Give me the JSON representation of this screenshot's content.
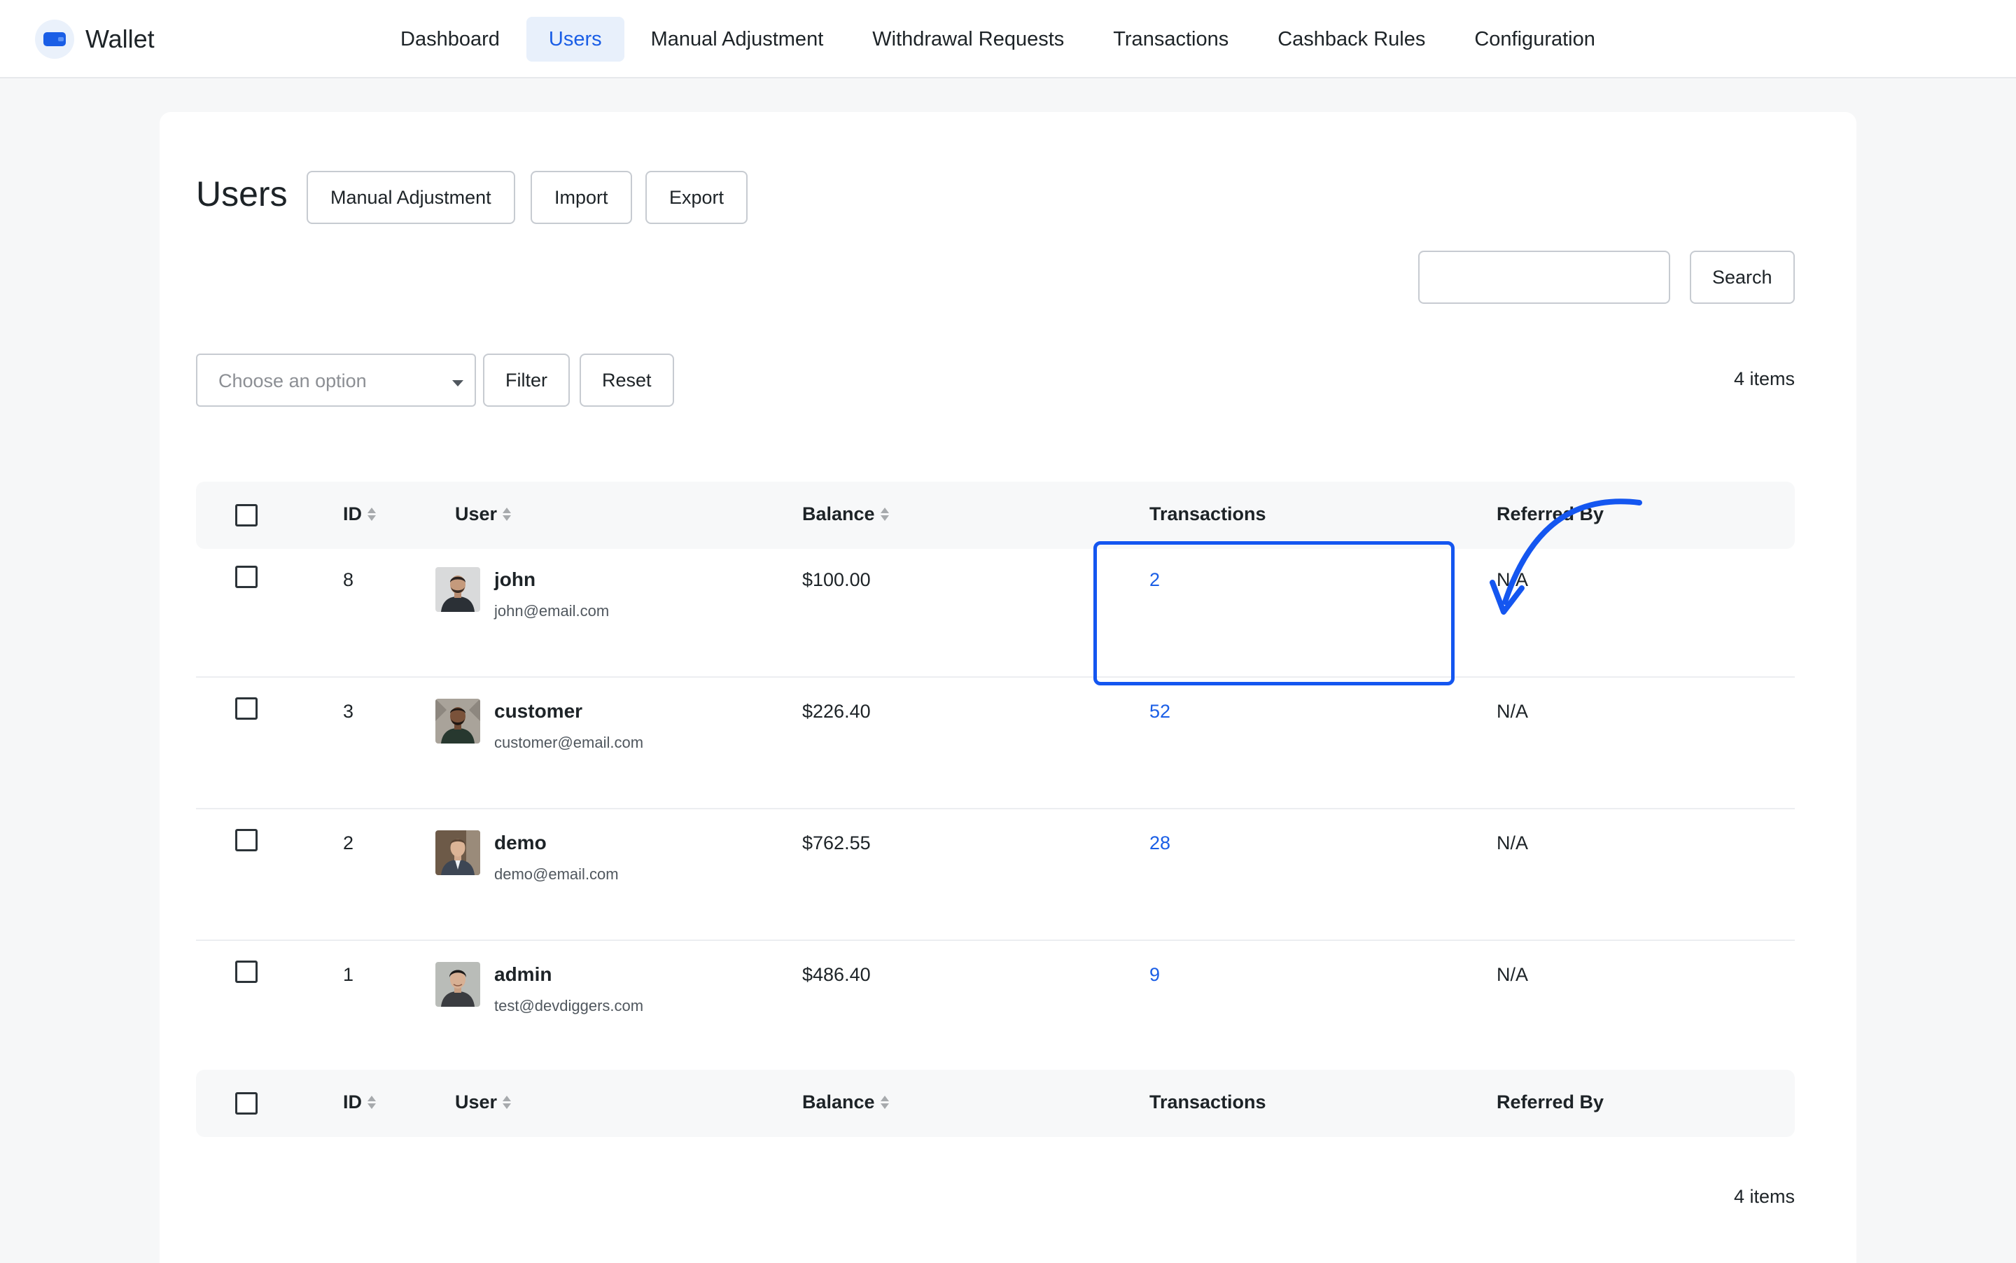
{
  "brand": {
    "name": "Wallet"
  },
  "nav": {
    "items": [
      {
        "label": "Dashboard"
      },
      {
        "label": "Users"
      },
      {
        "label": "Manual Adjustment"
      },
      {
        "label": "Withdrawal Requests"
      },
      {
        "label": "Transactions"
      },
      {
        "label": "Cashback Rules"
      },
      {
        "label": "Configuration"
      }
    ],
    "active": "Users"
  },
  "page": {
    "title": "Users",
    "actions": {
      "manual_adjustment": "Manual Adjustment",
      "import": "Import",
      "export": "Export"
    }
  },
  "search": {
    "value": "",
    "button": "Search"
  },
  "filter": {
    "select_placeholder": "Choose an option",
    "filter_button": "Filter",
    "reset_button": "Reset"
  },
  "items_count": "4 items",
  "table": {
    "columns": {
      "id": "ID",
      "user": "User",
      "balance": "Balance",
      "transactions": "Transactions",
      "referred_by": "Referred By"
    },
    "rows": [
      {
        "id": "8",
        "name": "john",
        "email": "john@email.com",
        "balance": "$100.00",
        "transactions": "2",
        "referred_by": "N/A"
      },
      {
        "id": "3",
        "name": "customer",
        "email": "customer@email.com",
        "balance": "$226.40",
        "transactions": "52",
        "referred_by": "N/A"
      },
      {
        "id": "2",
        "name": "demo",
        "email": "demo@email.com",
        "balance": "$762.55",
        "transactions": "28",
        "referred_by": "N/A"
      },
      {
        "id": "1",
        "name": "admin",
        "email": "test@devdiggers.com",
        "balance": "$486.40",
        "transactions": "9",
        "referred_by": "N/A"
      }
    ]
  },
  "colors": {
    "accent": "#1a5ee6",
    "annotation": "#1456f0",
    "page_background": "#f6f7f8"
  }
}
